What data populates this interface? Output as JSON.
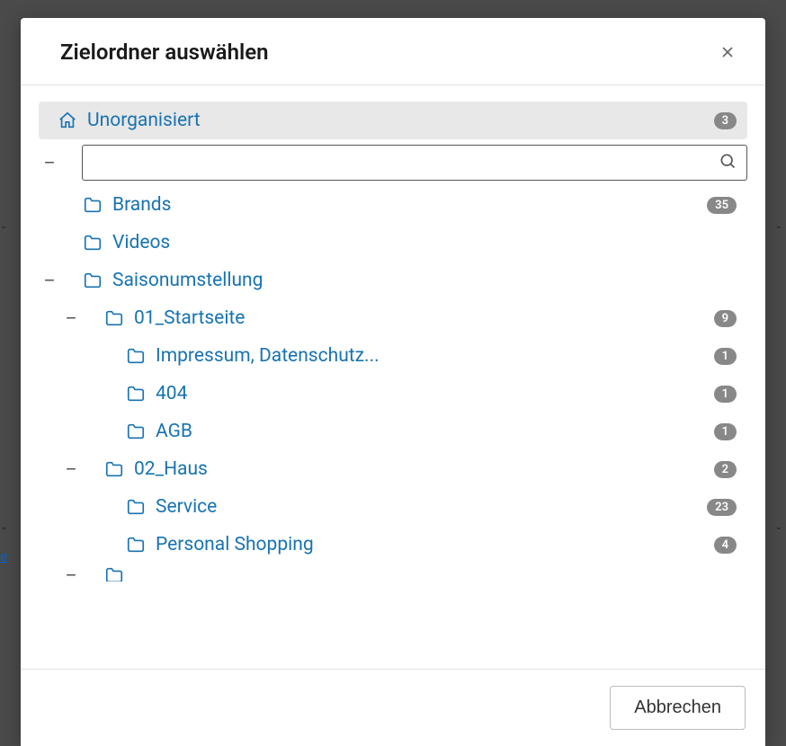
{
  "modal": {
    "title": "Zielordner auswählen",
    "cancel_label": "Abbrechen"
  },
  "tree": {
    "root": {
      "label": "Unorganisiert",
      "count": 3
    },
    "search": {
      "placeholder": ""
    },
    "items": [
      {
        "indent": 1,
        "label": "Brands",
        "count": 35,
        "expandable": false
      },
      {
        "indent": 1,
        "label": "Videos",
        "count": null,
        "expandable": false
      },
      {
        "indent": 1,
        "label": "Saisonumstellung",
        "count": null,
        "expandable": true
      },
      {
        "indent": 2,
        "label": "01_Startseite",
        "count": 9,
        "expandable": true
      },
      {
        "indent": 3,
        "label": "Impressum, Datenschutz...",
        "count": 1,
        "expandable": false
      },
      {
        "indent": 3,
        "label": "404",
        "count": 1,
        "expandable": false
      },
      {
        "indent": 3,
        "label": "AGB",
        "count": 1,
        "expandable": false
      },
      {
        "indent": 2,
        "label": "02_Haus",
        "count": 2,
        "expandable": true
      },
      {
        "indent": 3,
        "label": "Service",
        "count": 23,
        "expandable": false
      },
      {
        "indent": 3,
        "label": "Personal Shopping",
        "count": 4,
        "expandable": false
      }
    ]
  }
}
